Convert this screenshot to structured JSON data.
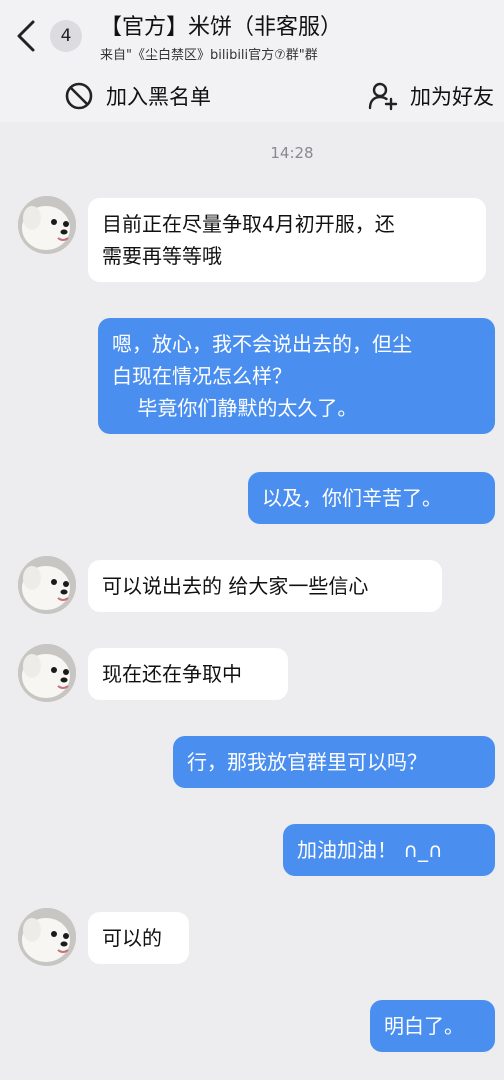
{
  "header": {
    "unread_count": "4",
    "title": "【官方】米饼（非客服）",
    "subtitle": "来自\"《尘白禁区》bilibili官方⑦群\"群",
    "block_label": "加入黑名单",
    "add_friend_label": "加为好友"
  },
  "timestamp": "14:28",
  "messages": [
    {
      "side": "in",
      "lines": [
        "目前正在尽量争取4月初开服，还",
        "需要再等等哦"
      ]
    },
    {
      "side": "out",
      "lines": [
        "嗯，放心，我不会说出去的，但尘",
        "白现在情况怎么样？",
        "    毕竟你们静默的太久了。"
      ]
    },
    {
      "side": "out",
      "lines": [
        "以及，你们辛苦了。"
      ]
    },
    {
      "side": "in",
      "lines": [
        "可以说出去的 给大家一些信心"
      ]
    },
    {
      "side": "in",
      "lines": [
        "现在还在争取中"
      ]
    },
    {
      "side": "out",
      "lines": [
        "行，那我放官群里可以吗？"
      ]
    },
    {
      "side": "out",
      "lines": [
        "加油加油！ ∩_∩"
      ]
    },
    {
      "side": "in",
      "lines": [
        "可以的"
      ]
    },
    {
      "side": "out",
      "lines": [
        "明白了。"
      ]
    }
  ],
  "colors": {
    "background": "#ededf0",
    "outgoing_bubble": "#4a8ff0",
    "incoming_bubble": "#ffffff"
  }
}
